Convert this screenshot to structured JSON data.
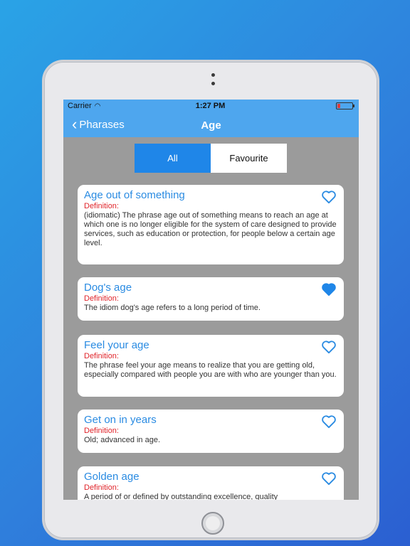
{
  "status_bar": {
    "carrier": "Carrier",
    "time": "1:27 PM"
  },
  "nav": {
    "back_label": "Pharases",
    "title": "Age"
  },
  "segment": {
    "all_label": "All",
    "favourite_label": "Favourite",
    "selected": "All"
  },
  "definition_label": "Definition:",
  "items": [
    {
      "phrase": "Age out of something",
      "meaning": "(idiomatic) The phrase  age out of something  means to reach an age at which one is no longer eligible for the system of care designed to provide services, such as education or protection, for people below a certain age level.",
      "favourite": false
    },
    {
      "phrase": "Dog's age",
      "meaning": "The idiom  dog's age  refers to a long period of time.",
      "favourite": true
    },
    {
      "phrase": "Feel your age",
      "meaning": "The phrase  feel your age  means to realize that you are getting old, especially compared with people you are with who are younger than you.",
      "favourite": false
    },
    {
      "phrase": "Get on in years",
      "meaning": "Old; advanced in age.",
      "favourite": false
    },
    {
      "phrase": "Golden age",
      "meaning": "A period of or defined by outstanding excellence, quality",
      "favourite": false
    }
  ],
  "colors": {
    "accent": "#2a8be2",
    "nav_bar": "#4ea6ee",
    "definition": "#e0242a",
    "segment_active": "#1f86e8"
  }
}
